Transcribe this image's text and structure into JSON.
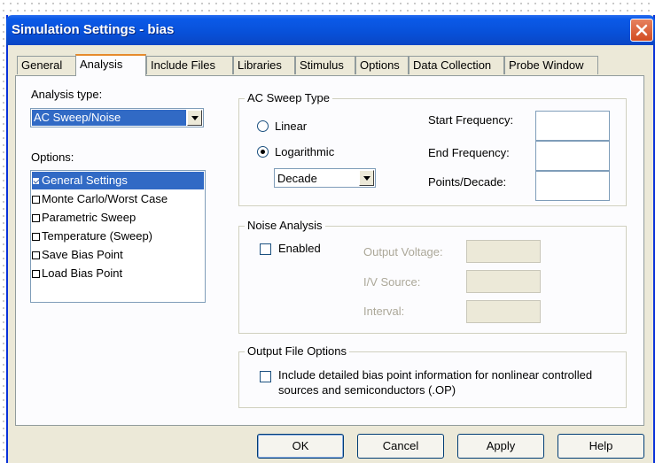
{
  "window": {
    "title": "Simulation Settings - bias"
  },
  "tabs": [
    {
      "label": "General"
    },
    {
      "label": "Analysis"
    },
    {
      "label": "Include Files"
    },
    {
      "label": "Libraries"
    },
    {
      "label": "Stimulus"
    },
    {
      "label": "Options"
    },
    {
      "label": "Data Collection"
    },
    {
      "label": "Probe Window"
    }
  ],
  "analysis": {
    "type_label": "Analysis type:",
    "type_value": "AC Sweep/Noise",
    "options_label": "Options:",
    "options": [
      {
        "label": "General Settings",
        "checked": true,
        "selected": true
      },
      {
        "label": "Monte Carlo/Worst Case",
        "checked": false
      },
      {
        "label": "Parametric Sweep",
        "checked": false
      },
      {
        "label": "Temperature (Sweep)",
        "checked": false
      },
      {
        "label": "Save Bias Point",
        "checked": false
      },
      {
        "label": "Load Bias Point",
        "checked": false
      }
    ]
  },
  "ac_sweep": {
    "title": "AC Sweep Type",
    "linear_label": "Linear",
    "log_label": "Logarithmic",
    "log_checked": true,
    "scale_value": "Decade",
    "start_label": "Start Frequency:",
    "start_value": "",
    "end_label": "End Frequency:",
    "end_value": "",
    "points_label": "Points/Decade:",
    "points_value": ""
  },
  "noise": {
    "title": "Noise Analysis",
    "enabled_label": "Enabled",
    "output_voltage_label": "Output Voltage:",
    "iv_source_label": "I/V Source:",
    "interval_label": "Interval:"
  },
  "output_file": {
    "title": "Output File Options",
    "include_line1": "Include detailed bias point information for nonlinear controlled",
    "include_line2": "sources and semiconductors (.OP)"
  },
  "buttons": {
    "ok": "OK",
    "cancel": "Cancel",
    "apply": "Apply",
    "help": "Help"
  },
  "colors": {
    "titlebar": "#0850d8",
    "selection": "#316ac5",
    "face": "#ece9d8"
  }
}
